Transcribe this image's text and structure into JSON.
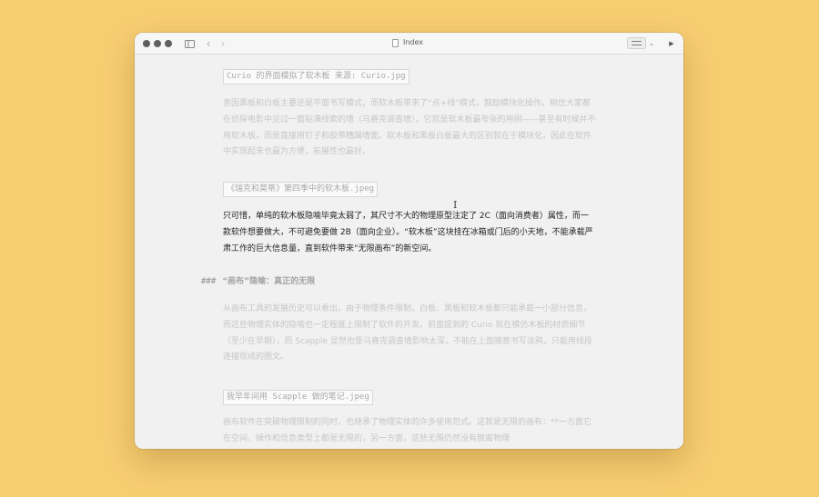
{
  "window": {
    "title": "Index"
  },
  "toolbar": {
    "sidebar_icon": "sidebar-toggle-icon",
    "back_icon": "chevron-left-icon",
    "forward_icon": "chevron-right-icon",
    "view_icon": "view-mode-icon",
    "view_chevron": "chevron-down-icon",
    "play_icon": "play-icon",
    "back_glyph": "‹",
    "forward_glyph": "›",
    "chevron_glyph": "⌄",
    "play_glyph": "▶"
  },
  "document": {
    "image_ref_1": "Curio 的界面模拟了软木板 来源: Curio.jpg",
    "para_1": "善因黑板和白板主要还是平面书写模式，而软木板带来了“点+线”模式，鼓励模块化操作。相信大家都在侦探电影中见过一面贴满线索的墙（马赛克调查墙），它就是软木板最夸张的用例——甚至有时候并不用软木板，而是直接用钉子和胶带糟蹋墙面。软木板和黑板白板最大的区别就在于模块化，因此在软件中实现起来也最为方便，拓展性也最好。",
    "image_ref_2": "《瑞克和莫蒂》第四季中的软木板.jpeg",
    "para_2": "只可惜，单纯的软木板隐喻毕竟太弱了，其尺寸不大的物理原型注定了 2C（面向消费者）属性，而一款软件想要做大，不可避免要做 2B（面向企业）。“软木板”这块挂在冰箱或门后的小天地，不能承载严肃工作的巨大信息量，直到软件带来“无限画布”的新空间。",
    "heading_mark": "###",
    "heading_text": "“画布”隐喻：真正的无限",
    "para_3": "从画布工具的发展历史可以看出，由于物理条件限制，白板、黑板和软木板都只能承载一小部分信息，而这些物理实体的隐喻也一定程度上限制了软件的开发。前面提到的 Curio 就在模仿木板的材质细节（至少在早期），而 Scapple 显然也受马赛克调查墙影响太深，不能在上面随意书写涂鸦，只能用线段连接现成的图文。",
    "image_ref_3": "我早年间用 Scapple 做的笔记.jpeg",
    "para_4": "画布软件在突破物理限制的同时，也继承了物理实体的许多使用范式。这就是无限的画布：**一方面它在空间、操作和信息类型上都是无限的，另一方面，这些无限仍然没有脱离物理"
  },
  "colors": {
    "background": "#f7cd72",
    "window": "#f2f1f1",
    "dim_text": "#c6c6c6",
    "focus_text": "#1f1f1f"
  }
}
